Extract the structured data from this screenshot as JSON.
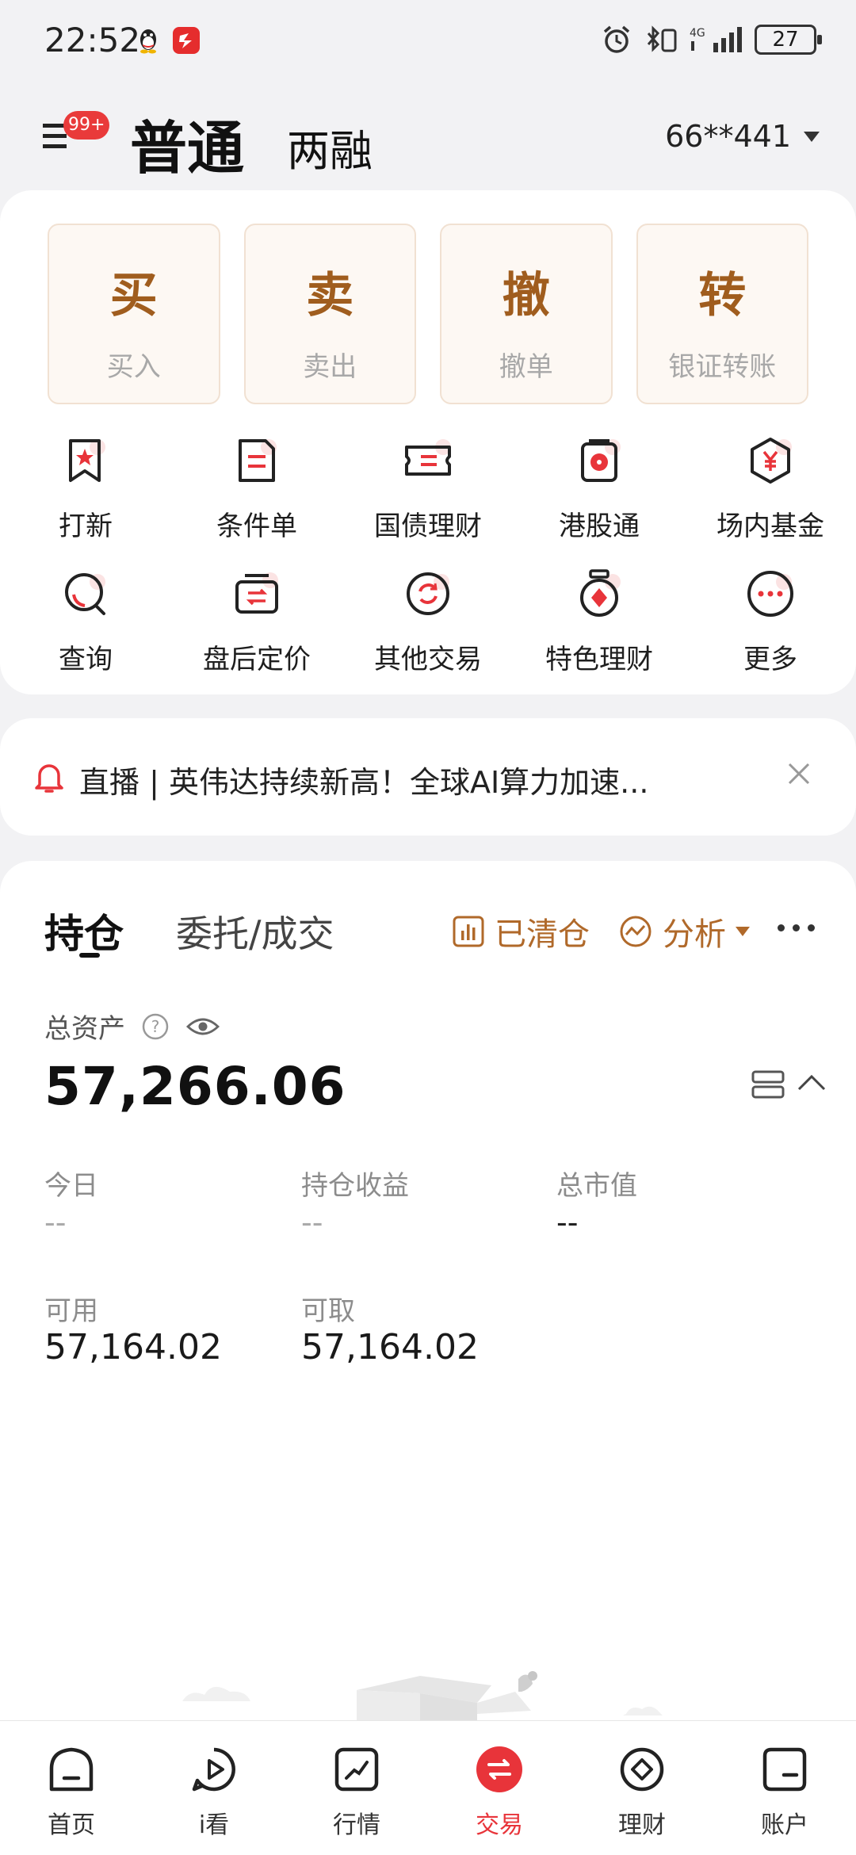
{
  "status_bar": {
    "time": "22:52",
    "battery": "27",
    "network": "4G"
  },
  "header": {
    "menu_badge": "99+",
    "tab_ordinary": "普通",
    "tab_margin": "两融",
    "account": "66**441"
  },
  "big_actions": [
    {
      "char": "买",
      "label": "买入"
    },
    {
      "char": "卖",
      "label": "卖出"
    },
    {
      "char": "撤",
      "label": "撤单"
    },
    {
      "char": "转",
      "label": "银证转账"
    }
  ],
  "grid": [
    {
      "label": "打新",
      "icon": "bookmark-star-icon"
    },
    {
      "label": "条件单",
      "icon": "document-icon"
    },
    {
      "label": "国债理财",
      "icon": "ticket-icon"
    },
    {
      "label": "港股通",
      "icon": "hk-flower-icon"
    },
    {
      "label": "场内基金",
      "icon": "yen-hexagon-icon"
    },
    {
      "label": "查询",
      "icon": "search-icon"
    },
    {
      "label": "盘后定价",
      "icon": "exchange-icon"
    },
    {
      "label": "其他交易",
      "icon": "refresh-icon"
    },
    {
      "label": "特色理财",
      "icon": "medal-icon"
    },
    {
      "label": "更多",
      "icon": "more-icon"
    }
  ],
  "notice": {
    "text": "直播 | 英伟达持续新高！全球AI算力加速..."
  },
  "positions": {
    "tab_holdings": "持仓",
    "tab_orders": "委托/成交",
    "cleared": "已清仓",
    "analysis": "分析",
    "total_assets_label": "总资产",
    "total_assets": "57,266.06",
    "today_label": "今日",
    "today_value": "--",
    "holding_profit_label": "持仓收益",
    "holding_profit_value": "--",
    "market_value_label": "总市值",
    "market_value_value": "--",
    "available_label": "可用",
    "available_value": "57,164.02",
    "withdrawable_label": "可取",
    "withdrawable_value": "57,164.02"
  },
  "bottom_nav": [
    {
      "label": "首页",
      "icon": "home-icon"
    },
    {
      "label": "i看",
      "icon": "play-icon"
    },
    {
      "label": "行情",
      "icon": "chart-icon"
    },
    {
      "label": "交易",
      "icon": "trade-icon",
      "active": true
    },
    {
      "label": "理财",
      "icon": "finance-icon"
    },
    {
      "label": "账户",
      "icon": "account-icon"
    }
  ],
  "colors": {
    "accent": "#e8343a",
    "brand_brown": "#a05d1e",
    "gold": "#b0692a"
  }
}
